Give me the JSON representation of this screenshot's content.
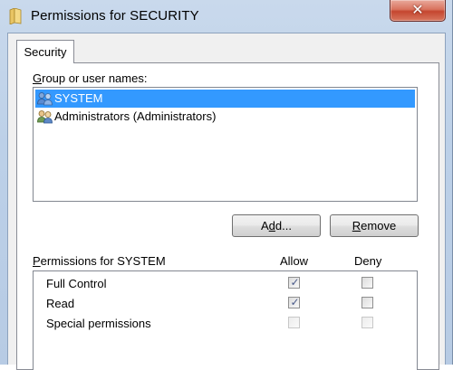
{
  "window": {
    "title": "Permissions for SECURITY",
    "close_glyph": "✕"
  },
  "tabs": [
    {
      "label": "Security",
      "selected": true
    }
  ],
  "group_list": {
    "label_access_key": "G",
    "label_rest": "roup or user names:",
    "items": [
      {
        "label": "SYSTEM",
        "selected": true,
        "icon": "users-icon"
      },
      {
        "label": "Administrators (Administrators)",
        "selected": false,
        "icon": "users-icon"
      }
    ]
  },
  "buttons": {
    "add_access_key": "d",
    "add_before": "A",
    "add_after": "d...",
    "remove_access_key": "R",
    "remove_rest": "emove"
  },
  "permissions": {
    "header_access_key": "P",
    "header_rest": "ermissions for SYSTEM",
    "allow_label": "Allow",
    "deny_label": "Deny",
    "rows": [
      {
        "name": "Full Control",
        "allow": true,
        "deny": false,
        "enabled": true
      },
      {
        "name": "Read",
        "allow": true,
        "deny": false,
        "enabled": true
      },
      {
        "name": "Special permissions",
        "allow": false,
        "deny": false,
        "enabled": false
      }
    ]
  },
  "colors": {
    "selection": "#3399ff",
    "close_button": "#c4462f",
    "frame": "#bcd0e8"
  }
}
